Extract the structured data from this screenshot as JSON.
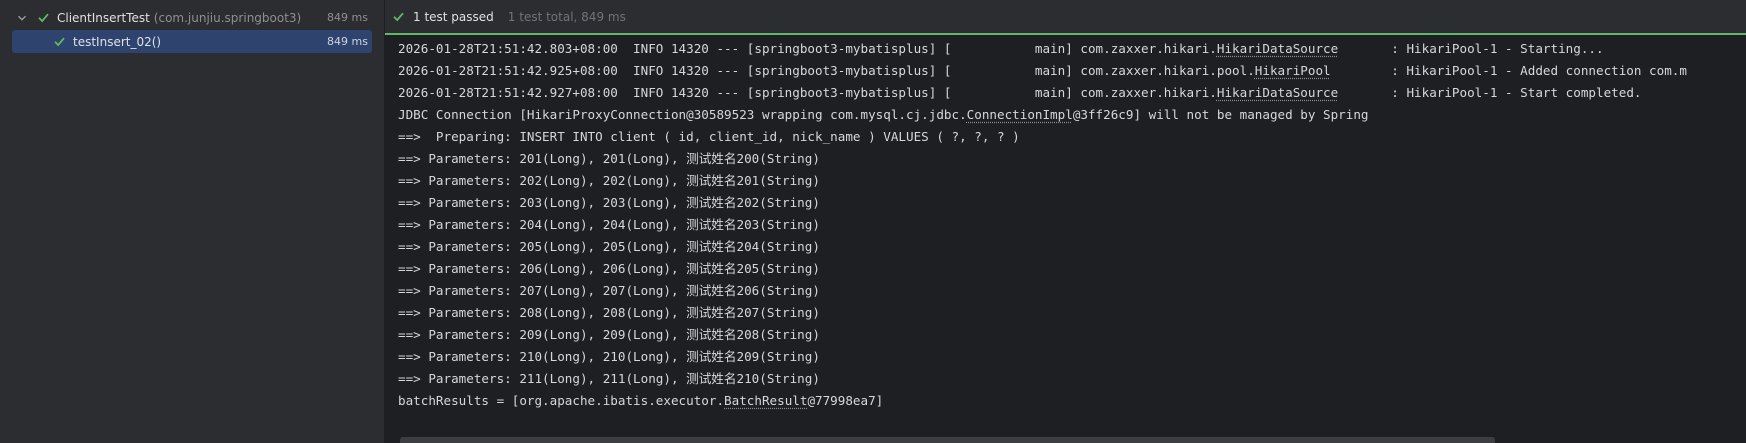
{
  "tree": {
    "root": {
      "name": "ClientInsertTest",
      "package": "(com.junjiu.springboot3)",
      "time": "849 ms"
    },
    "child": {
      "name": "testInsert_02()",
      "time": "849 ms"
    }
  },
  "header": {
    "status": "1 test passed",
    "summary": "1 test total, 849 ms"
  },
  "console": {
    "lines": [
      {
        "pre": "2026-01-28T21:51:42.803+08:00  INFO 14320 --- [springboot3-mybatisplus] [           main] com.zaxxer.hikari.",
        "ul": "HikariDataSource",
        "post": "       : HikariPool-1 - Starting..."
      },
      {
        "pre": "2026-01-28T21:51:42.925+08:00  INFO 14320 --- [springboot3-mybatisplus] [           main] com.zaxxer.hikari.pool.",
        "ul": "HikariPool",
        "post": "        : HikariPool-1 - Added connection com.m"
      },
      {
        "pre": "2026-01-28T21:51:42.927+08:00  INFO 14320 --- [springboot3-mybatisplus] [           main] com.zaxxer.hikari.",
        "ul": "HikariDataSource",
        "post": "       : HikariPool-1 - Start completed."
      },
      {
        "pre": "JDBC Connection [HikariProxyConnection@30589523 wrapping com.mysql.cj.jdbc.",
        "ul": "ConnectionImpl",
        "post": "@3ff26c9] will not be managed by Spring"
      },
      {
        "pre": "==>  Preparing: INSERT INTO client ( id, client_id, nick_name ) VALUES ( ?, ?, ? )",
        "ul": "",
        "post": ""
      },
      {
        "pre": "==> Parameters: 201(Long), 201(Long), 测试姓名200(String)",
        "ul": "",
        "post": ""
      },
      {
        "pre": "==> Parameters: 202(Long), 202(Long), 测试姓名201(String)",
        "ul": "",
        "post": ""
      },
      {
        "pre": "==> Parameters: 203(Long), 203(Long), 测试姓名202(String)",
        "ul": "",
        "post": ""
      },
      {
        "pre": "==> Parameters: 204(Long), 204(Long), 测试姓名203(String)",
        "ul": "",
        "post": ""
      },
      {
        "pre": "==> Parameters: 205(Long), 205(Long), 测试姓名204(String)",
        "ul": "",
        "post": ""
      },
      {
        "pre": "==> Parameters: 206(Long), 206(Long), 测试姓名205(String)",
        "ul": "",
        "post": ""
      },
      {
        "pre": "==> Parameters: 207(Long), 207(Long), 测试姓名206(String)",
        "ul": "",
        "post": ""
      },
      {
        "pre": "==> Parameters: 208(Long), 208(Long), 测试姓名207(String)",
        "ul": "",
        "post": ""
      },
      {
        "pre": "==> Parameters: 209(Long), 209(Long), 测试姓名208(String)",
        "ul": "",
        "post": ""
      },
      {
        "pre": "==> Parameters: 210(Long), 210(Long), 测试姓名209(String)",
        "ul": "",
        "post": ""
      },
      {
        "pre": "==> Parameters: 211(Long), 211(Long), 测试姓名210(String)",
        "ul": "",
        "post": ""
      },
      {
        "pre": "batchResults = [org.apache.ibatis.executor.",
        "ul": "BatchResult",
        "post": "@77998ea7]"
      }
    ]
  },
  "icons": {
    "check": "check-icon",
    "chevron": "chevron-down-icon"
  },
  "colors": {
    "pass_green": "#5fb865",
    "selection": "#2e436e"
  }
}
